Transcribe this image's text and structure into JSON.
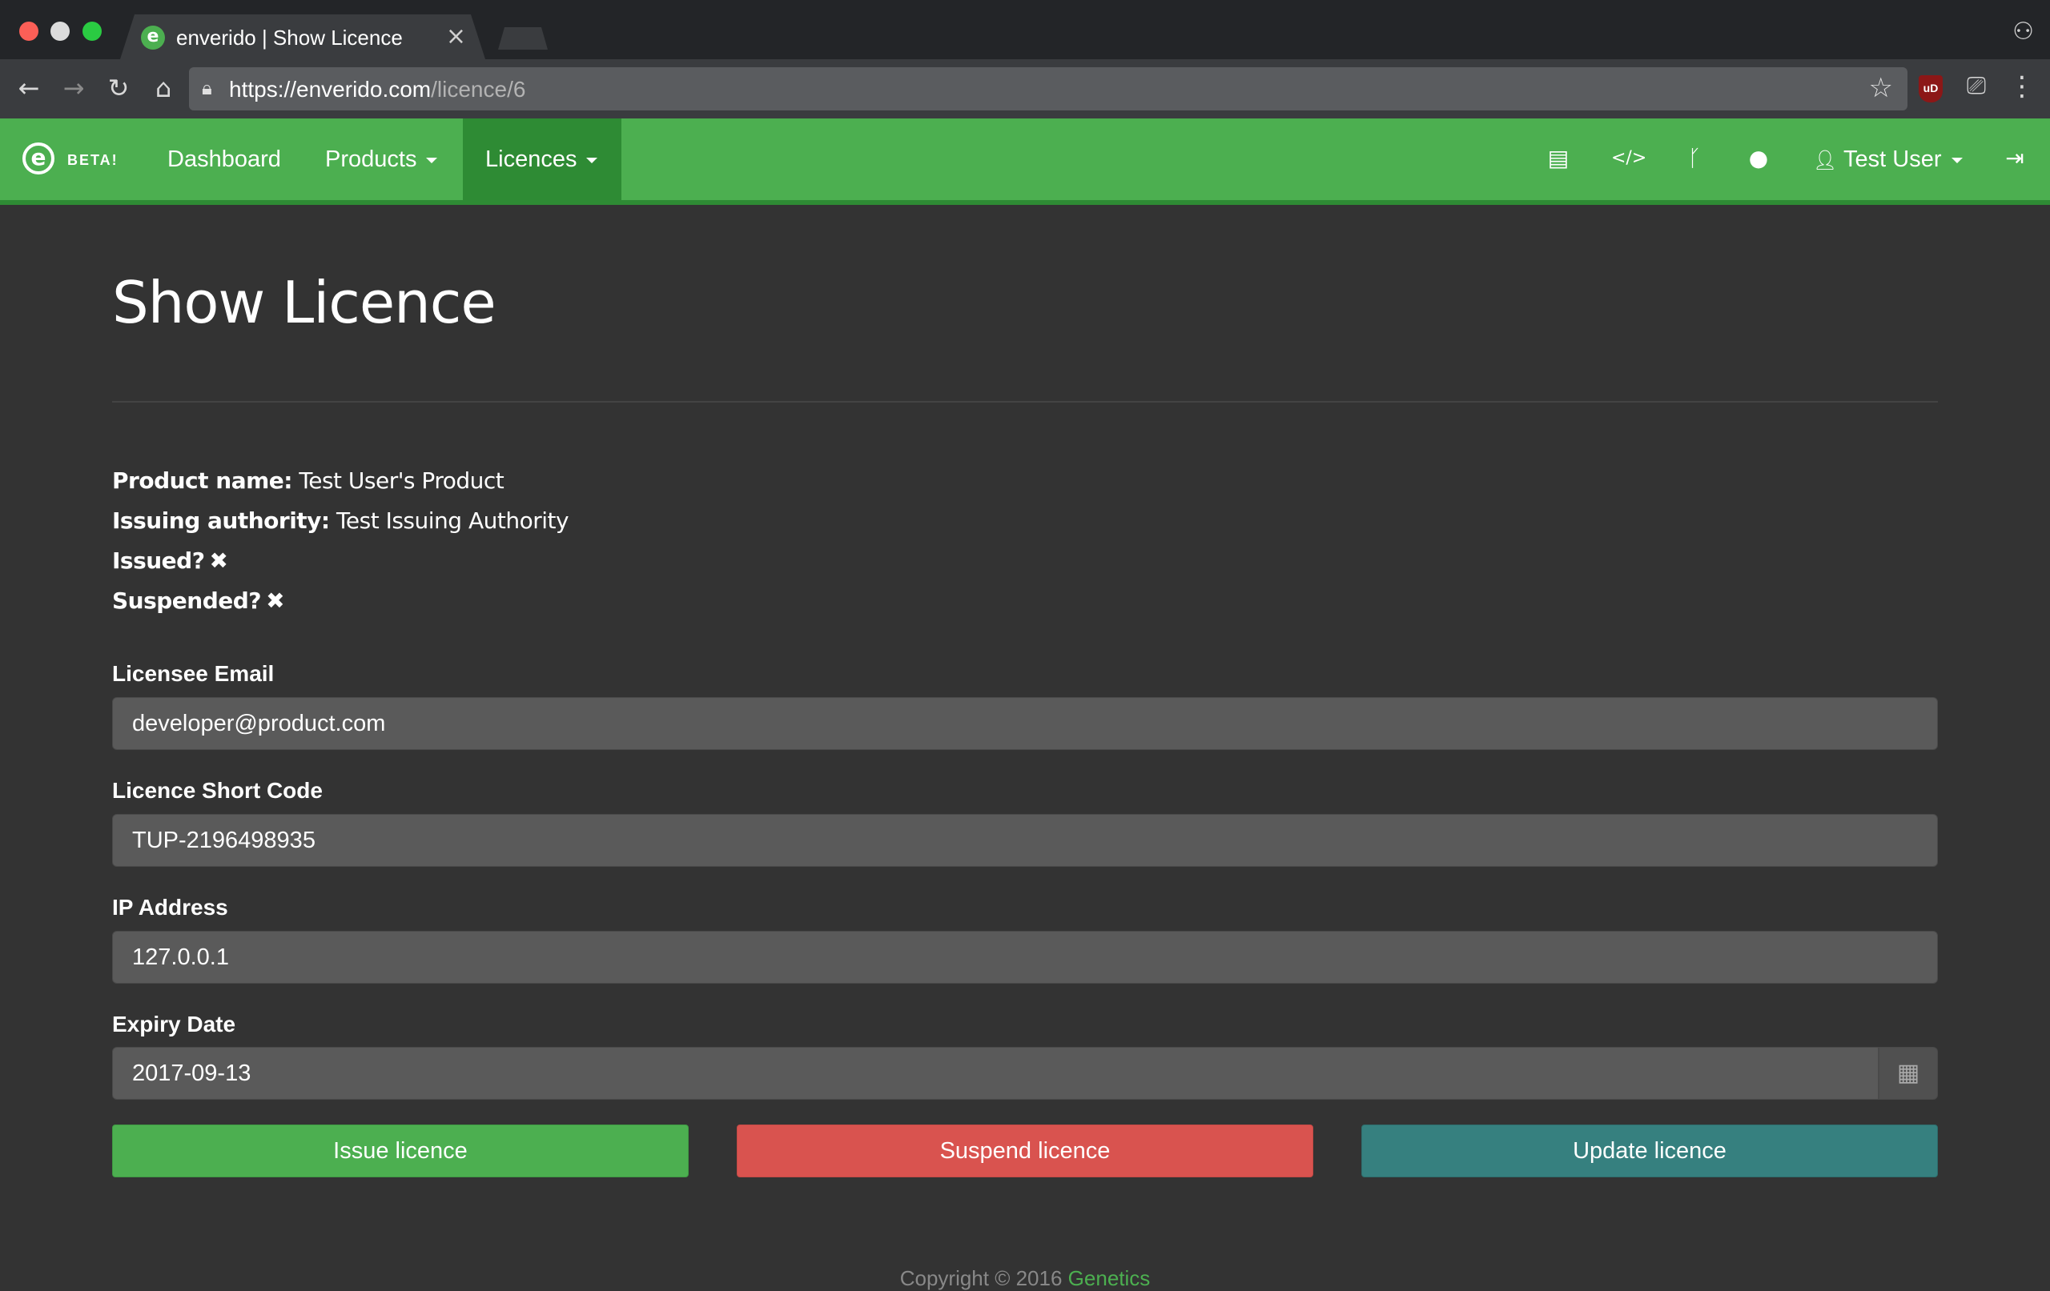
{
  "browser": {
    "tab_title": "enverido | Show Licence",
    "tab_close": "×",
    "url_host": "https://enverido.com",
    "url_path": "/licence/6",
    "icons": {
      "back": "arrow-left-icon",
      "forward": "arrow-right-icon",
      "reload": "reload-icon",
      "home": "home-icon",
      "lock": "lock-icon",
      "bookmark": "star-icon",
      "ublock": "ublock-icon",
      "cast": "cast-icon",
      "menu": "kebab-menu-icon",
      "incognito": "incognito-icon"
    },
    "ublock_label": "uD"
  },
  "navbar": {
    "brand_beta": "BETA!",
    "items": [
      {
        "label": "Dashboard"
      },
      {
        "label": "Products"
      },
      {
        "label": "Licences"
      }
    ],
    "user_label": "Test User",
    "colors": {
      "bar": "#4caf50",
      "active": "#2e8b34"
    },
    "icons": [
      "book-icon",
      "code-icon",
      "branch-icon",
      "alert-icon",
      "user-icon",
      "sign-out-icon"
    ]
  },
  "page": {
    "title": "Show Licence",
    "details": {
      "product_label": "Product name:",
      "product_value": "Test User's Product",
      "authority_label": "Issuing authority:",
      "authority_value": "Test Issuing Authority",
      "issued_label": "Issued?",
      "issued_value": "✖",
      "suspended_label": "Suspended?",
      "suspended_value": "✖"
    },
    "fields": {
      "email_label": "Licensee Email",
      "email_value": "developer@product.com",
      "code_label": "Licence Short Code",
      "code_value": "TUP-2196498935",
      "ip_label": "IP Address",
      "ip_value": "127.0.0.1",
      "expiry_label": "Expiry Date",
      "expiry_value": "2017-09-13"
    },
    "buttons": {
      "issue": "Issue licence",
      "suspend": "Suspend licence",
      "update": "Update licence"
    },
    "button_colors": {
      "issue": "#4caf50",
      "suspend": "#d9534f",
      "update": "#36807f"
    },
    "footer_text": "Copyright © 2016",
    "footer_link": "Genetics"
  }
}
